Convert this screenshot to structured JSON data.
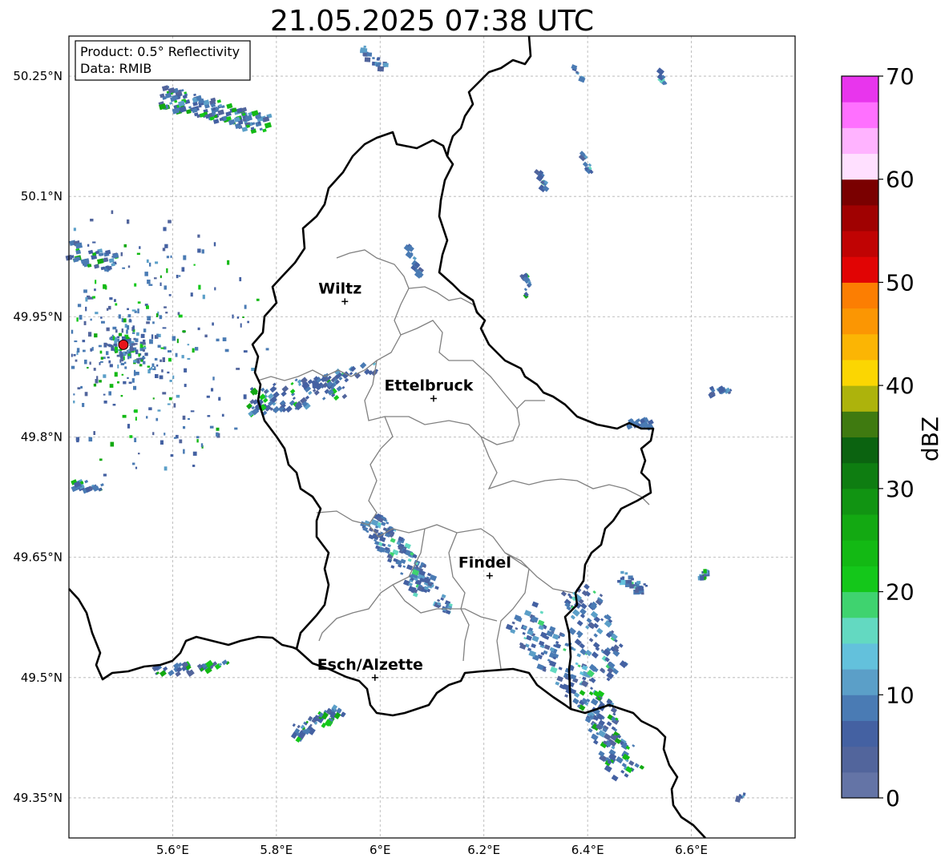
{
  "title": "21.05.2025 07:38 UTC",
  "info": {
    "product": "Product: 0.5° Reflectivity",
    "data": "Data: RMIB"
  },
  "lon_ticks": [
    {
      "value": 5.6,
      "label": "5.6°E"
    },
    {
      "value": 5.8,
      "label": "5.8°E"
    },
    {
      "value": 6.0,
      "label": "6°E"
    },
    {
      "value": 6.2,
      "label": "6.2°E"
    },
    {
      "value": 6.4,
      "label": "6.4°E"
    },
    {
      "value": 6.6,
      "label": "6.6°E"
    }
  ],
  "lat_ticks": [
    {
      "value": 50.25,
      "label": "50.25°N"
    },
    {
      "value": 50.1,
      "label": "50.1°N"
    },
    {
      "value": 49.95,
      "label": "49.95°N"
    },
    {
      "value": 49.8,
      "label": "49.8°N"
    },
    {
      "value": 49.65,
      "label": "49.65°N"
    },
    {
      "value": 49.5,
      "label": "49.5°N"
    },
    {
      "value": 49.35,
      "label": "49.35°N"
    }
  ],
  "map_extent": {
    "lon": [
      5.4,
      6.8
    ],
    "lat": [
      49.3,
      50.3
    ]
  },
  "cities": [
    {
      "name": "Wiltz",
      "lon": 5.932,
      "lat": 49.969
    },
    {
      "name": "Ettelbruck",
      "lon": 6.103,
      "lat": 49.848
    },
    {
      "name": "Findel",
      "lon": 6.211,
      "lat": 49.627
    },
    {
      "name": "Esch/Alzette",
      "lon": 5.99,
      "lat": 49.5
    }
  ],
  "radar_site": {
    "lon": 5.505,
    "lat": 49.915,
    "color": "#e8141a"
  },
  "colorbar": {
    "label": "dBZ",
    "min": 0,
    "max": 70,
    "ticks": [
      {
        "value": 0,
        "label": "0"
      },
      {
        "value": 10,
        "label": "10"
      },
      {
        "value": 20,
        "label": "20"
      },
      {
        "value": 30,
        "label": "30"
      },
      {
        "value": 40,
        "label": "40"
      },
      {
        "value": 50,
        "label": "50"
      },
      {
        "value": 60,
        "label": "60"
      },
      {
        "value": 70,
        "label": "70"
      }
    ],
    "colors": [
      "#6474a6",
      "#52659c",
      "#4461a2",
      "#4a7bb4",
      "#5b9fc8",
      "#63c1dc",
      "#63d9c1",
      "#3fd36f",
      "#14c71a",
      "#13b914",
      "#13a912",
      "#119412",
      "#0e7d11",
      "#0b6310",
      "#3f7a10",
      "#adb30c",
      "#fbd602",
      "#fbb504",
      "#fb9603",
      "#fc7e02",
      "#e10404",
      "#c00303",
      "#a00101",
      "#7a0000",
      "#ffe0ff",
      "#ffb3ff",
      "#ff70ff",
      "#e835ed"
    ]
  },
  "colors": {
    "country_border": "#000000",
    "canton_border": "#808080",
    "grid": "#b0b0b0"
  }
}
